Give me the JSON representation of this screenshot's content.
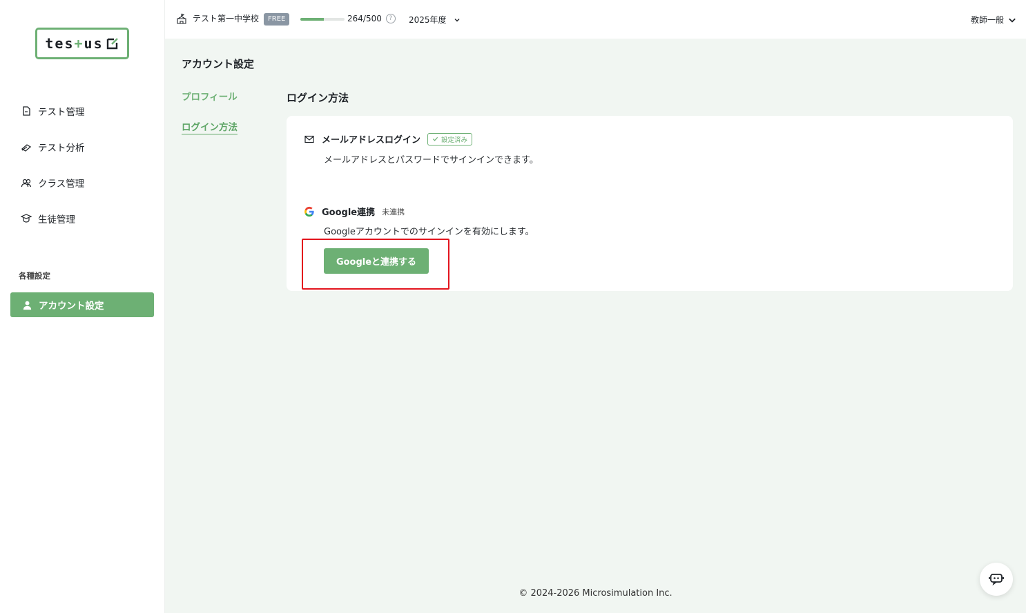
{
  "logo": {
    "prefix": "tes",
    "plus": "+",
    "suffix": "us"
  },
  "sidebar": {
    "items": [
      {
        "label": "テスト管理",
        "icon": "document-icon"
      },
      {
        "label": "テスト分析",
        "icon": "analysis-icon"
      },
      {
        "label": "クラス管理",
        "icon": "group-icon"
      },
      {
        "label": "生徒管理",
        "icon": "student-icon"
      }
    ],
    "section_label": "各種設定",
    "active_item": {
      "label": "アカウント設定",
      "icon": "user-icon"
    }
  },
  "header": {
    "school": "テスト第一中学校",
    "plan": "FREE",
    "usage": "264/500",
    "usage_fraction": 0.528,
    "year": "2025年度",
    "user_role": "教師一般"
  },
  "main": {
    "page_title": "アカウント設定",
    "subnav": {
      "profile": "プロフィール",
      "login": "ログイン方法"
    },
    "section_title": "ログイン方法",
    "email_login": {
      "title": "メールアドレスログイン",
      "badge": "設定済み",
      "description": "メールアドレスとパスワードでサインインできます。"
    },
    "google": {
      "title": "Google連携",
      "status": "未連携",
      "description": "Googleアカウントでのサインインを有効にします。",
      "button": "Googleと連携する"
    }
  },
  "footer": {
    "copyright": "© 2024-2026 Microsimulation Inc."
  },
  "colors": {
    "accent": "#6db074",
    "highlight": "#e3141d"
  }
}
